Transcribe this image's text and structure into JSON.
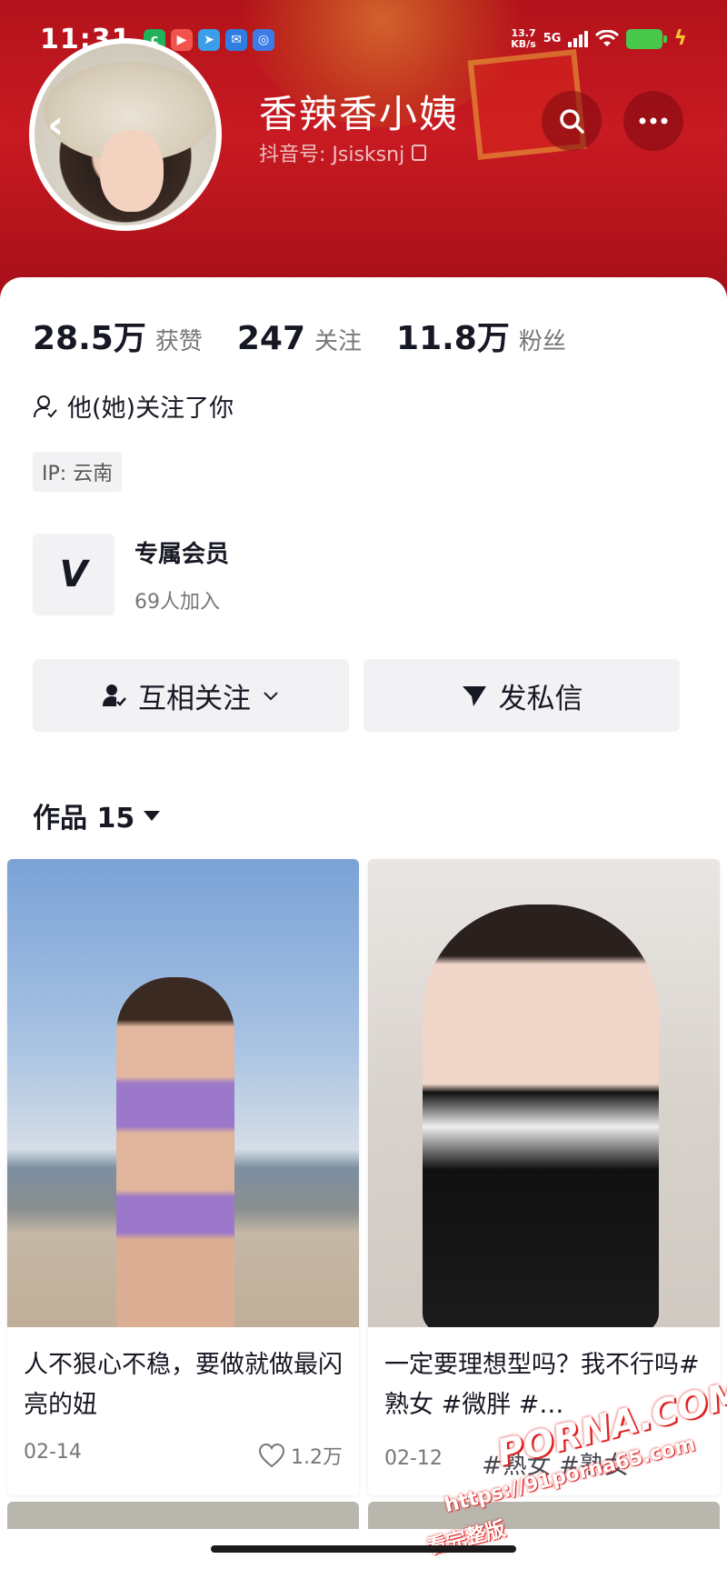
{
  "status_bar": {
    "time": "11:31",
    "net_speed": "13.7",
    "net_speed_unit": "KB/s",
    "net_type": "5G",
    "app_icons": [
      "app-icon-c",
      "app-icon-video",
      "app-icon-telegram",
      "app-icon-message",
      "app-icon-circle"
    ],
    "app_colors": [
      "#20b15a",
      "#f2534c",
      "#3a9ee8",
      "#2f7de1",
      "#3d7be6"
    ]
  },
  "profile": {
    "nickname": "香辣香小姨",
    "douyin_id": "抖音号: Jsisksnj",
    "stats": [
      {
        "value": "28.5万",
        "label": "获赞"
      },
      {
        "value": "247",
        "label": "关注"
      },
      {
        "value": "11.8万",
        "label": "粉丝"
      }
    ],
    "follows_you": "他(她)关注了你",
    "ip": "IP: 云南"
  },
  "membership": {
    "logo": "V",
    "title": "专属会员",
    "count": "69人加入"
  },
  "actions": {
    "mutual_follow": "互相关注",
    "message": "发私信"
  },
  "works": {
    "tab_label": "作品 15",
    "videos": [
      {
        "title": "人不狠心不稳，要做就做最闪亮的妞",
        "date": "02-14",
        "likes": "1.2万"
      },
      {
        "title": "一定要理想型吗？我不行吗#熟女 #微胖 #…",
        "date": "02-12",
        "likes": ""
      }
    ]
  },
  "watermark": {
    "logo": "PORNA.COM",
    "url": "https://91porna65.com",
    "tag": "看完整版",
    "overlay_text": "#熟女 #熟女"
  },
  "colors": {
    "header_red": "#c81a22",
    "text_primary": "#161823",
    "text_secondary": "#777777",
    "button_bg": "#f2f2f4"
  }
}
